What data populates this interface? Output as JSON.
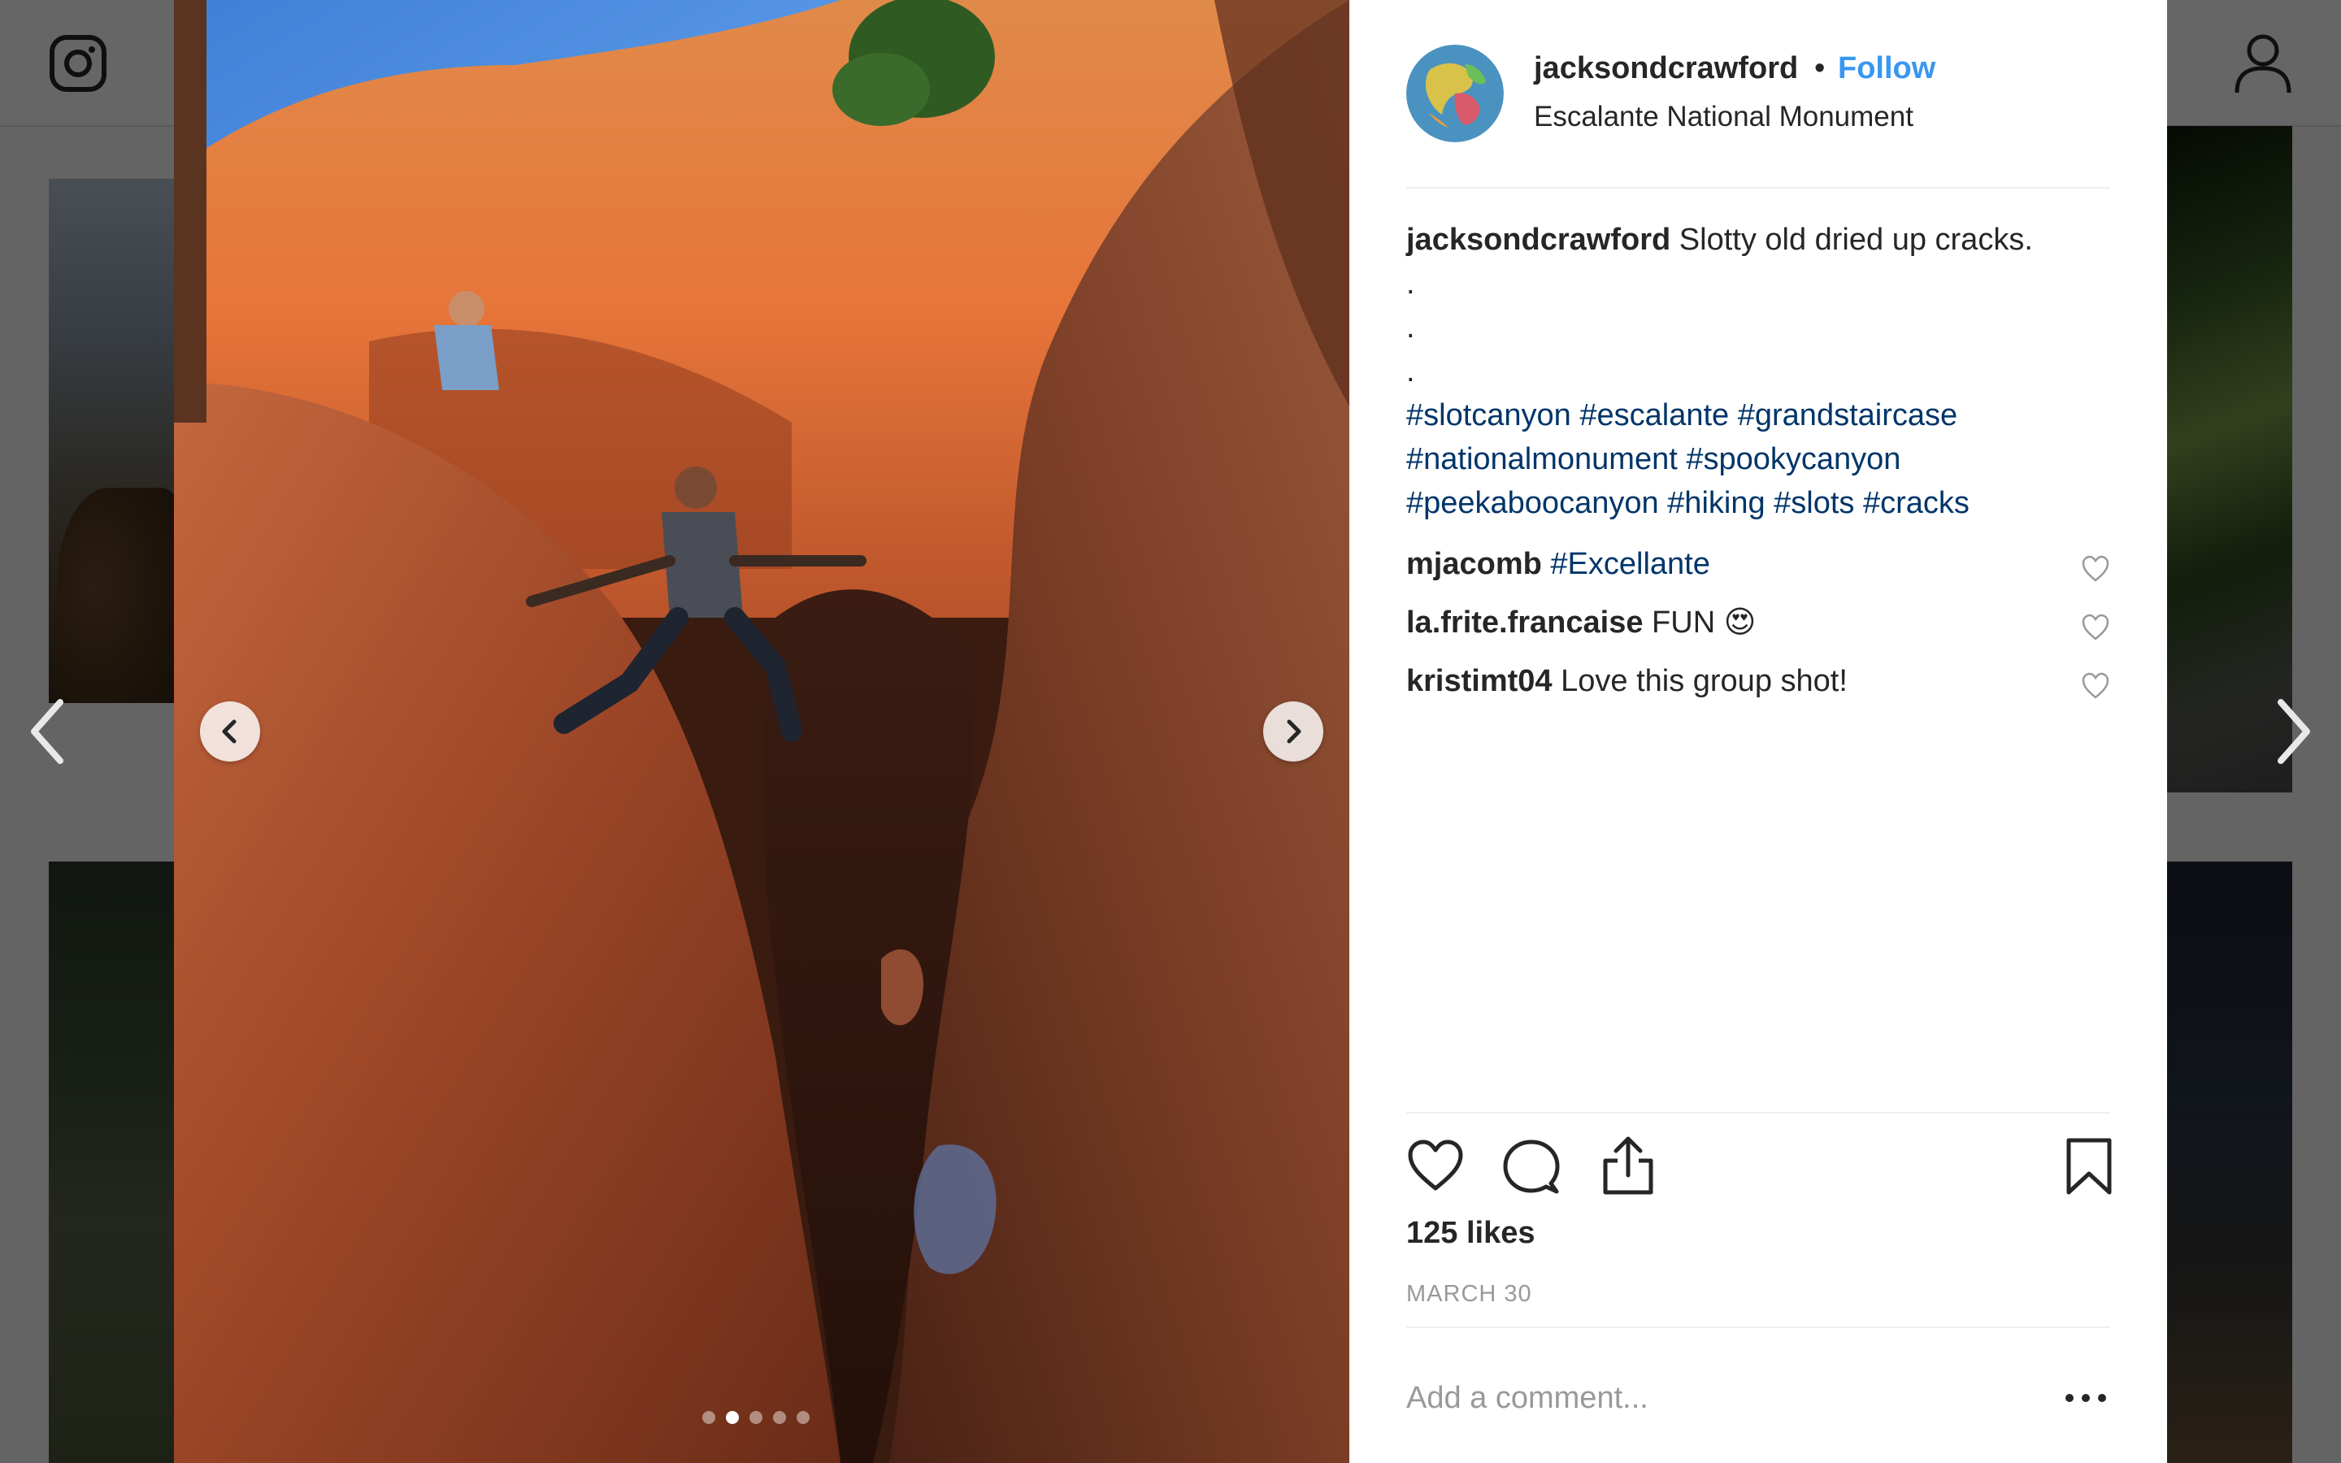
{
  "post": {
    "username": "jacksondcrawford",
    "separator": "•",
    "follow_label": "Follow",
    "location": "Escalante National Monument",
    "caption_text": "Slotty old dried up cracks.",
    "caption_dots": [
      ".",
      ".",
      "."
    ],
    "hashtags": [
      "#slotcanyon",
      "#escalante",
      "#grandstaircase",
      "#nationalmonument",
      "#spookycanyon",
      "#peekaboocanyon",
      "#hiking",
      "#slots",
      "#cracks"
    ]
  },
  "comments": [
    {
      "username": "mjacomb",
      "text": "",
      "tag": "#Excellante",
      "emoji": ""
    },
    {
      "username": "la.frite.francaise",
      "text": "FUN",
      "tag": "",
      "emoji": "😍"
    },
    {
      "username": "kristimt04",
      "text": "Love this group shot!",
      "tag": "",
      "emoji": ""
    }
  ],
  "likes": "125 likes",
  "date": "MARCH 30",
  "comment_input": {
    "placeholder": "Add a comment...",
    "value": ""
  },
  "carousel": {
    "slide_count": 5,
    "active_index": 1
  },
  "icons": {
    "header_left": "instagram-logo-icon",
    "header_right": "profile-icon",
    "actions": [
      "heart-icon",
      "comment-icon",
      "share-icon",
      "bookmark-icon"
    ],
    "more": "more-options-icon"
  },
  "colors": {
    "link_blue": "#3897f0",
    "hashtag": "#003569",
    "text": "#262626",
    "muted": "#999999"
  }
}
